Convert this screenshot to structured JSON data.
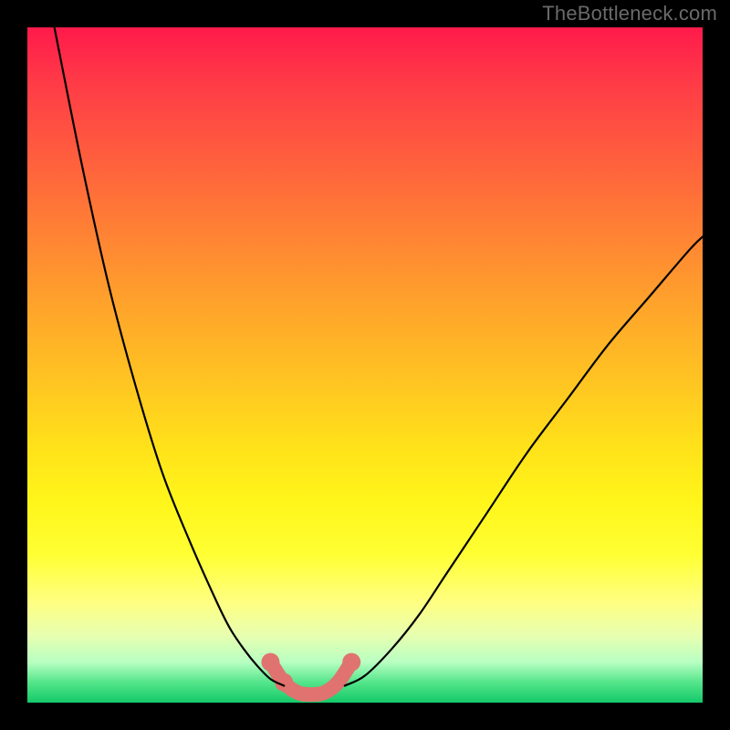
{
  "watermark": "TheBottleneck.com",
  "chart_data": {
    "type": "line",
    "title": "",
    "xlabel": "",
    "ylabel": "",
    "xlim": [
      0,
      100
    ],
    "ylim": [
      0,
      100
    ],
    "grid": false,
    "legend": false,
    "series": [
      {
        "name": "left-curve",
        "x": [
          4,
          8,
          12,
          16,
          20,
          24,
          28,
          30,
          32,
          34,
          36,
          38
        ],
        "y": [
          100,
          80,
          62,
          47,
          34,
          24,
          15,
          11,
          8,
          5.5,
          3.5,
          2.5
        ]
      },
      {
        "name": "right-curve",
        "x": [
          47,
          50,
          54,
          58,
          62,
          68,
          74,
          80,
          86,
          92,
          98,
          100
        ],
        "y": [
          2.5,
          4,
          8,
          13,
          19,
          28,
          37,
          45,
          53,
          60,
          67,
          69
        ]
      },
      {
        "name": "optimal-band",
        "x": [
          36,
          38,
          40,
          42,
          44,
          46,
          48
        ],
        "y": [
          6,
          3,
          1.5,
          1.2,
          1.5,
          3,
          6
        ]
      }
    ],
    "annotations": [
      {
        "name": "left-dot-upper",
        "x": 36,
        "y": 6
      },
      {
        "name": "left-dot-lower",
        "x": 38,
        "y": 3
      },
      {
        "name": "right-dot",
        "x": 48,
        "y": 6
      }
    ],
    "background_gradient": {
      "top": "#ff1a4b",
      "mid": "#ffe11a",
      "bottom": "#14c96a"
    }
  }
}
